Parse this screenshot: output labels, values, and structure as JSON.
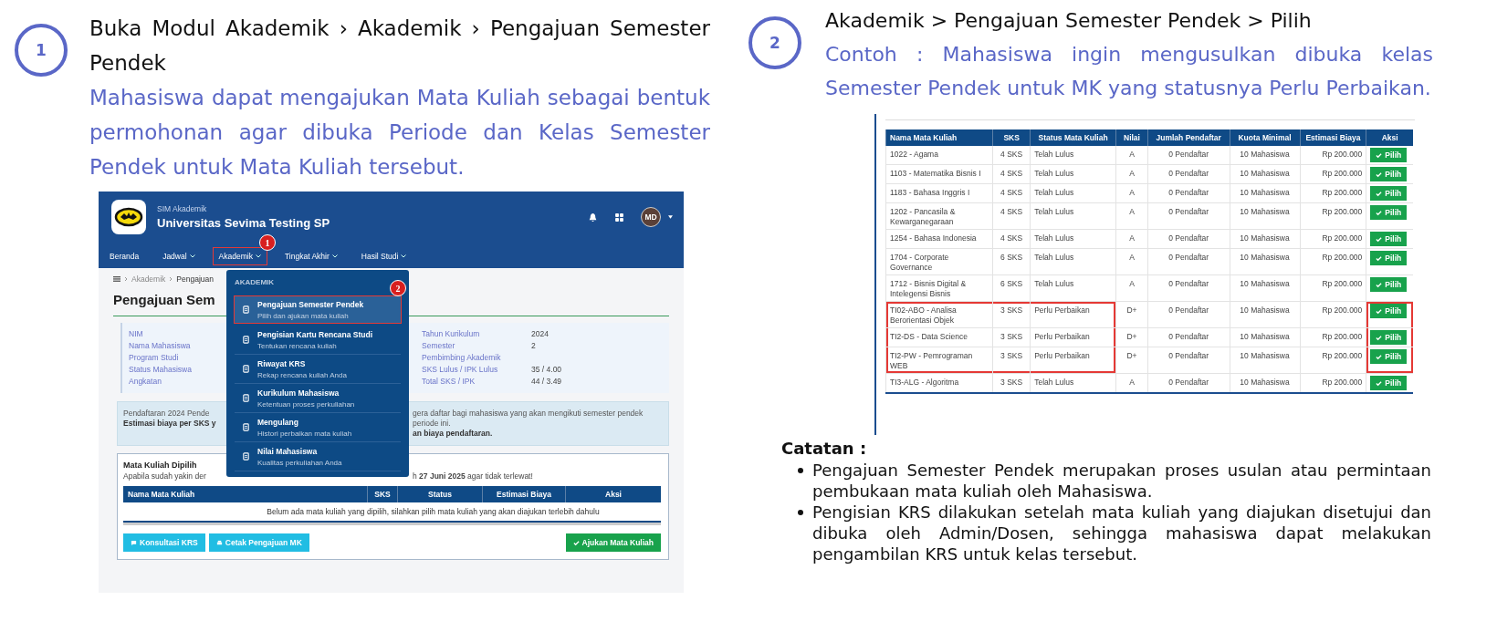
{
  "steps": [
    {
      "number": "1",
      "title": "Buka Modul Akademik › Akademik › Pengajuan Semester Pendek",
      "description": "Mahasiswa dapat mengajukan Mata Kuliah sebagai bentuk permohonan agar dibuka Periode dan Kelas Semester Pendek untuk Mata Kuliah tersebut."
    },
    {
      "number": "2",
      "title": "Akademik > Pengajuan Semester Pendek > Pilih",
      "description": "Contoh : Mahasiswa ingin mengusulkan dibuka kelas Semester Pendek untuk MK yang statusnya Perlu Perbaikan."
    }
  ],
  "app_screen": {
    "app_label": "SIM Akademik",
    "university": "Universitas Sevima Testing SP",
    "avatar": "MD",
    "nav": [
      {
        "label": "Beranda",
        "dropdown": false,
        "highlighted": false
      },
      {
        "label": "Jadwal",
        "dropdown": true,
        "highlighted": false
      },
      {
        "label": "Akademik",
        "dropdown": true,
        "highlighted": true,
        "callout": "1"
      },
      {
        "label": "Tingkat Akhir",
        "dropdown": true,
        "highlighted": false
      },
      {
        "label": "Hasil Studi",
        "dropdown": true,
        "highlighted": false
      }
    ],
    "breadcrumb": [
      "Akademik",
      "Pengajuan"
    ],
    "page_title": "Pengajuan Sem",
    "profile_left": [
      "NIM",
      "Nama Mahasiswa",
      "Program Studi",
      "Status Mahasiswa",
      "Angkatan"
    ],
    "profile_right": [
      {
        "label": "Tahun Kurikulum",
        "value": "2024"
      },
      {
        "label": "Semester",
        "value": "2"
      },
      {
        "label": "Pembimbing Akademik"
      },
      {
        "label": "SKS Lulus / IPK Lulus",
        "value": "35 / 4.00"
      },
      {
        "label": "Total SKS / IPK",
        "value": "44 / 3.49"
      }
    ],
    "alert": {
      "line1_left": "Pendaftaran 2024 Pende",
      "line1_right": "gera daftar bagi mahasiswa yang akan mengikuti semester pendek periode ini.",
      "line2_left": "Estimasi biaya per SKS y",
      "line2_right": "an biaya pendaftaran."
    },
    "selected_card": {
      "title": "Mata Kuliah Dipilih",
      "note_left": "Apabila sudah yakin der",
      "note_right": "h **27 Juni 2025** agar tidak terlewat!",
      "columns": [
        "Nama Mata Kuliah",
        "SKS",
        "Status",
        "Estimasi Biaya",
        "Aksi"
      ],
      "empty": "Belum ada mata kuliah yang dipilih, silahkan pilih mata kuliah yang akan diajukan terlebih dahulu"
    },
    "buttons": [
      {
        "label": "Konsultasi KRS",
        "kind": "info"
      },
      {
        "label": "Cetak Pengajuan MK",
        "kind": "info"
      },
      {
        "label": "Ajukan Mata Kuliah",
        "kind": "success"
      }
    ],
    "menu": {
      "heading": "AKADEMIK",
      "items": [
        {
          "title": "Pengajuan Semester Pendek",
          "subtitle": "Pilih dan ajukan mata kuliah",
          "selected": true,
          "callout": "2"
        },
        {
          "title": "Pengisian Kartu Rencana Studi",
          "subtitle": "Tentukan rencana kuliah",
          "selected": false
        },
        {
          "title": "Riwayat KRS",
          "subtitle": "Rekap rencana kuliah Anda",
          "selected": false
        },
        {
          "title": "Kurikulum Mahasiswa",
          "subtitle": "Ketentuan proses perkuliahan",
          "selected": false
        },
        {
          "title": "Mengulang",
          "subtitle": "Histori perbaikan mata kuliah",
          "selected": false
        },
        {
          "title": "Nilai Mahasiswa",
          "subtitle": "Kualitas perkuliahan Anda",
          "selected": false
        }
      ]
    }
  },
  "course_table": {
    "columns": [
      "Nama Mata Kuliah",
      "SKS",
      "Status Mata Kuliah",
      "Nilai",
      "Jumlah Pendaftar",
      "Kuota Minimal",
      "Estimasi Biaya",
      "Aksi"
    ],
    "rows": [
      {
        "course": "1022 - Agama",
        "sks": "4 SKS",
        "status": "Telah Lulus",
        "grade": "A",
        "registrants": "0 Pendaftar",
        "quota": "10 Mahasiswa",
        "cost": "Rp 200.000",
        "action": "Pilih",
        "highlighted": false
      },
      {
        "course": "1103 - Matematika Bisnis I",
        "sks": "4 SKS",
        "status": "Telah Lulus",
        "grade": "A",
        "registrants": "0 Pendaftar",
        "quota": "10 Mahasiswa",
        "cost": "Rp 200.000",
        "action": "Pilih",
        "highlighted": false
      },
      {
        "course": "1183 - Bahasa Inggris I",
        "sks": "4 SKS",
        "status": "Telah Lulus",
        "grade": "A",
        "registrants": "0 Pendaftar",
        "quota": "10 Mahasiswa",
        "cost": "Rp 200.000",
        "action": "Pilih",
        "highlighted": false
      },
      {
        "course": "1202 - Pancasila & Kewarganegaraan",
        "sks": "4 SKS",
        "status": "Telah Lulus",
        "grade": "A",
        "registrants": "0 Pendaftar",
        "quota": "10 Mahasiswa",
        "cost": "Rp 200.000",
        "action": "Pilih",
        "highlighted": false
      },
      {
        "course": "1254 - Bahasa Indonesia",
        "sks": "4 SKS",
        "status": "Telah Lulus",
        "grade": "A",
        "registrants": "0 Pendaftar",
        "quota": "10 Mahasiswa",
        "cost": "Rp 200.000",
        "action": "Pilih",
        "highlighted": false
      },
      {
        "course": "1704 - Corporate Governance",
        "sks": "6 SKS",
        "status": "Telah Lulus",
        "grade": "A",
        "registrants": "0 Pendaftar",
        "quota": "10 Mahasiswa",
        "cost": "Rp 200.000",
        "action": "Pilih",
        "highlighted": false
      },
      {
        "course": "1712 - Bisnis Digital & Intelegensi Bisnis",
        "sks": "6 SKS",
        "status": "Telah Lulus",
        "grade": "A",
        "registrants": "0 Pendaftar",
        "quota": "10 Mahasiswa",
        "cost": "Rp 200.000",
        "action": "Pilih",
        "highlighted": false
      },
      {
        "course": "TI02-ABO - Analisa Berorientasi Objek",
        "sks": "3 SKS",
        "status": "Perlu Perbaikan",
        "grade": "D+",
        "registrants": "0 Pendaftar",
        "quota": "10 Mahasiswa",
        "cost": "Rp 200.000",
        "action": "Pilih",
        "highlighted": true
      },
      {
        "course": "TI2-DS - Data Science",
        "sks": "3 SKS",
        "status": "Perlu Perbaikan",
        "grade": "D+",
        "registrants": "0 Pendaftar",
        "quota": "10 Mahasiswa",
        "cost": "Rp 200.000",
        "action": "Pilih",
        "highlighted": true
      },
      {
        "course": "TI2-PW - Pemrograman WEB",
        "sks": "3 SKS",
        "status": "Perlu Perbaikan",
        "grade": "D+",
        "registrants": "0 Pendaftar",
        "quota": "10 Mahasiswa",
        "cost": "Rp 200.000",
        "action": "Pilih",
        "highlighted": true
      },
      {
        "course": "TI3-ALG - Algoritma",
        "sks": "3 SKS",
        "status": "Telah Lulus",
        "grade": "A",
        "registrants": "0 Pendaftar",
        "quota": "10 Mahasiswa",
        "cost": "Rp 200.000",
        "action": "Pilih",
        "highlighted": false
      }
    ]
  },
  "notes": {
    "title": "Catatan :",
    "items": [
      "Pengajuan Semester Pendek merupakan proses usulan atau permintaan pembukaan mata kuliah oleh Mahasiswa.",
      "Pengisian KRS dilakukan setelah mata kuliah yang diajukan disetujui dan dibuka oleh Admin/Dosen, sehingga mahasiswa dapat melakukan pengambilan KRS untuk kelas tersebut."
    ]
  }
}
